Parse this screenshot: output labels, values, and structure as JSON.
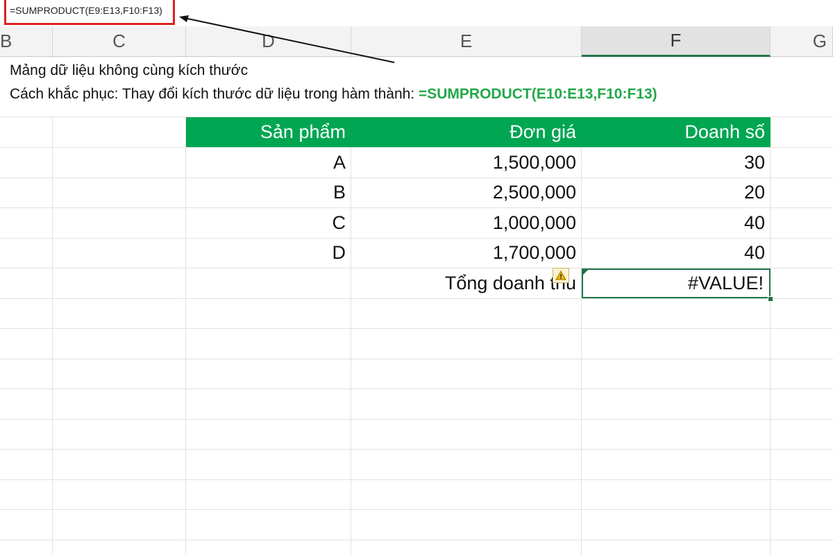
{
  "formula_bar": {
    "text": "=SUMPRODUCT(E9:E13,F10:F13)"
  },
  "columns": [
    "B",
    "C",
    "D",
    "E",
    "F",
    "G"
  ],
  "annotation": {
    "line1": "Mảng dữ liệu không cùng kích thước",
    "line2_prefix": "Cách khắc phục: Thay đổi kích thước dữ liệu trong hàm thành: ",
    "line2_fix": "=SUMPRODUCT(E10:E13,F10:F13)"
  },
  "table": {
    "headers": [
      "Sản phẩm",
      "Đơn giá",
      "Doanh số"
    ],
    "rows": [
      [
        "A",
        "1,500,000",
        "30"
      ],
      [
        "B",
        "2,500,000",
        "20"
      ],
      [
        "C",
        "1,000,000",
        "40"
      ],
      [
        "D",
        "1,700,000",
        "40"
      ]
    ],
    "total_label": "Tổng doanh thu",
    "total_value": "#VALUE!"
  },
  "icons": {
    "warning": "warning-icon",
    "error_indicator": "error-triangle-icon"
  },
  "colors": {
    "header_fill": "#00a651",
    "fix_text": "#22a84a",
    "highlight_box": "#e02020",
    "selection": "#217346"
  }
}
